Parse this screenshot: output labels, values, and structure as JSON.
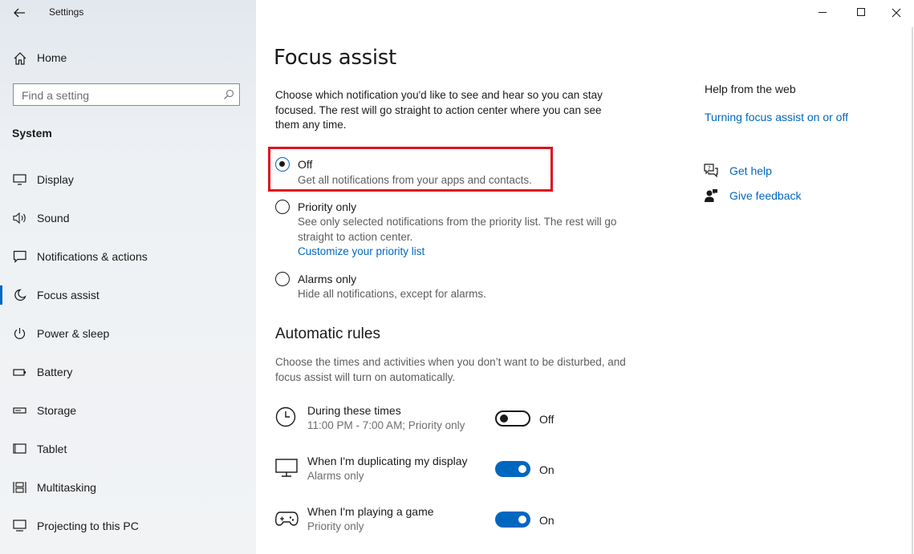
{
  "window": {
    "title": "Settings",
    "minimize_icon": "minimize-icon",
    "maximize_icon": "maximize-icon",
    "close_icon": "close-icon"
  },
  "sidebar": {
    "home_label": "Home",
    "search_placeholder": "Find a setting",
    "section_title": "System",
    "items": [
      {
        "label": "Display",
        "icon": "display-icon"
      },
      {
        "label": "Sound",
        "icon": "speaker-icon"
      },
      {
        "label": "Notifications & actions",
        "icon": "notification-icon"
      },
      {
        "label": "Focus assist",
        "icon": "moon-icon",
        "selected": true
      },
      {
        "label": "Power & sleep",
        "icon": "power-icon"
      },
      {
        "label": "Battery",
        "icon": "battery-icon"
      },
      {
        "label": "Storage",
        "icon": "storage-icon"
      },
      {
        "label": "Tablet",
        "icon": "tablet-icon"
      },
      {
        "label": "Multitasking",
        "icon": "multitasking-icon"
      },
      {
        "label": "Projecting to this PC",
        "icon": "project-icon"
      }
    ]
  },
  "main": {
    "title": "Focus assist",
    "intro": "Choose which notification you'd like to see and hear so you can stay focused. The rest will go straight to action center where you can see them any time.",
    "options": [
      {
        "title": "Off",
        "desc": "Get all notifications from your apps and contacts.",
        "selected": true
      },
      {
        "title": "Priority only",
        "desc": "See only selected notifications from the priority list. The rest will go straight to action center.",
        "link": "Customize your priority list",
        "selected": false
      },
      {
        "title": "Alarms only",
        "desc": "Hide all notifications, except for alarms.",
        "selected": false
      }
    ],
    "rules_title": "Automatic rules",
    "rules_desc": "Choose the times and activities when you don’t want to be disturbed, and focus assist will turn on automatically.",
    "rules": [
      {
        "title": "During these times",
        "sub": "11:00 PM - 7:00 AM; Priority only",
        "state": "Off",
        "on": false,
        "icon": "clock-icon"
      },
      {
        "title": "When I'm duplicating my display",
        "sub": "Alarms only",
        "state": "On",
        "on": true,
        "icon": "monitor-icon"
      },
      {
        "title": "When I'm playing a game",
        "sub": "Priority only",
        "state": "On",
        "on": true,
        "icon": "gamepad-icon"
      }
    ]
  },
  "help": {
    "title": "Help from the web",
    "link": "Turning focus assist on or off",
    "get_help": "Get help",
    "give_feedback": "Give feedback"
  },
  "colors": {
    "accent": "#0067c0",
    "highlight": "#e0111b"
  }
}
